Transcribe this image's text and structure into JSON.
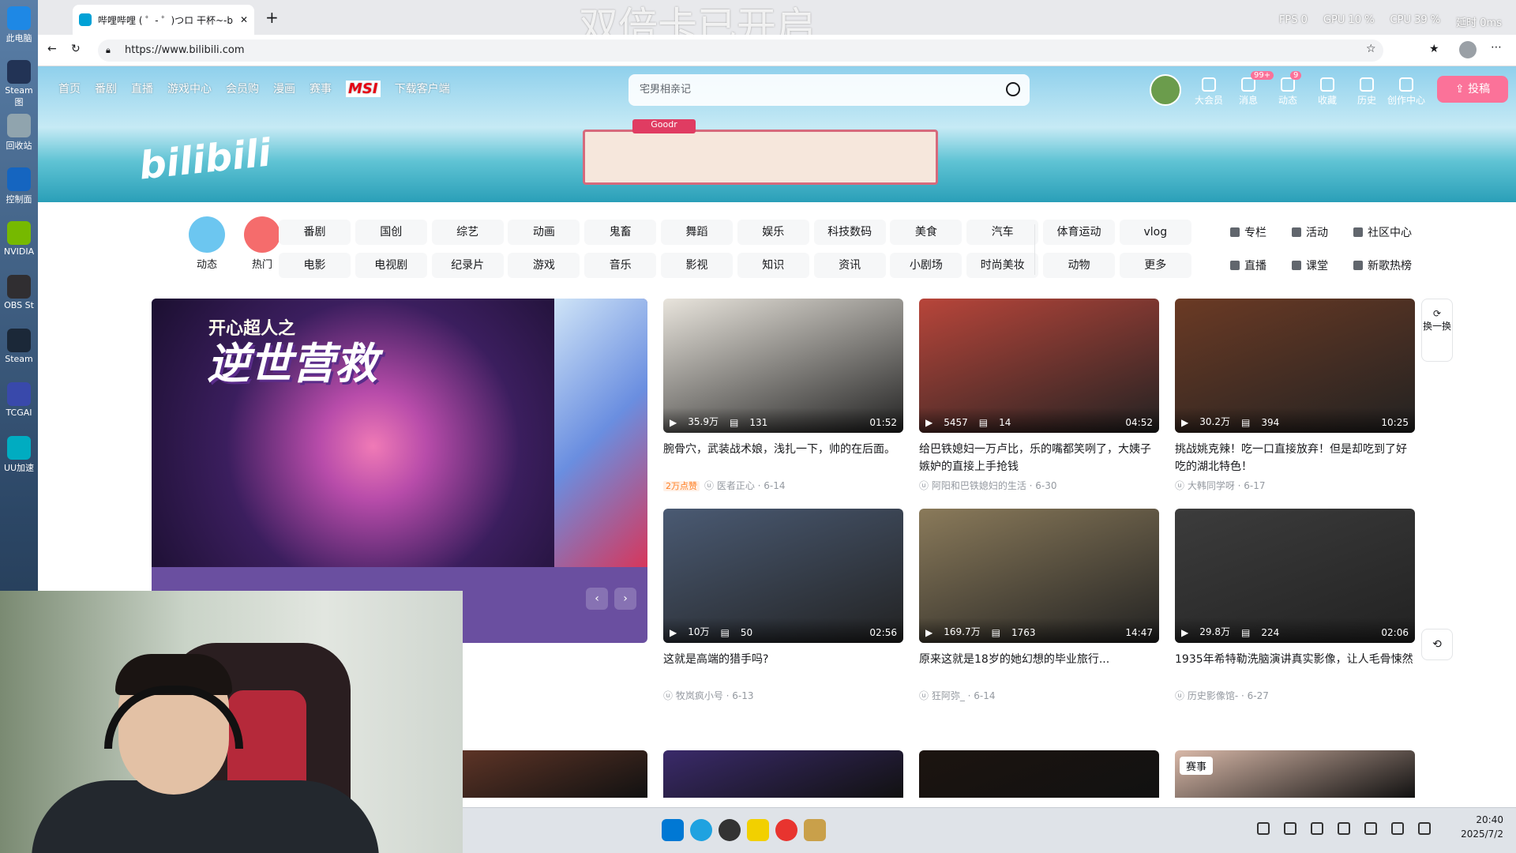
{
  "desktop": {
    "icons": [
      {
        "label": "此电脑",
        "color": "#1e88e5"
      },
      {
        "label": "Steam图",
        "color": "#223355"
      },
      {
        "label": "回收站",
        "color": "#90a4ae"
      },
      {
        "label": "控制面",
        "color": "#1565c0"
      },
      {
        "label": "NVIDIA",
        "color": "#76b900"
      },
      {
        "label": "OBS St",
        "color": "#302e31"
      },
      {
        "label": "Steam",
        "color": "#1b2838"
      },
      {
        "label": "TCGAI",
        "color": "#3949ab"
      },
      {
        "label": "UU加速",
        "color": "#00acc1"
      }
    ]
  },
  "overlay": {
    "text": "双倍卡已开启"
  },
  "stats": {
    "fps_label": "FPS",
    "fps": "0",
    "gpu_label": "GPU",
    "gpu": "10 %",
    "cpu_label": "CPU",
    "cpu": "39 %",
    "latency": "延时 0ms"
  },
  "browser": {
    "tab_title": "哔哩哔哩 ( ゜- ゜)つロ 干杯~-bilibili",
    "url": "https://www.bilibili.com"
  },
  "header": {
    "nav": [
      "首页",
      "番剧",
      "直播",
      "游戏中心",
      "会员购",
      "漫画",
      "赛事"
    ],
    "msi": "MSI",
    "download": "下载客户端",
    "search_placeholder": "宅男相亲记",
    "right_nav": [
      {
        "label": "大会员",
        "badge": ""
      },
      {
        "label": "消息",
        "badge": "99+"
      },
      {
        "label": "动态",
        "badge": "9"
      },
      {
        "label": "收藏",
        "badge": ""
      },
      {
        "label": "历史",
        "badge": ""
      },
      {
        "label": "创作中心",
        "badge": ""
      }
    ],
    "upload": "投稿",
    "logo": "bilibili"
  },
  "channels": {
    "quick": [
      {
        "label": "动态",
        "color": "#6cc6f0"
      },
      {
        "label": "热门",
        "color": "#f56c6c"
      }
    ],
    "row1": [
      "番剧",
      "国创",
      "综艺",
      "动画",
      "鬼畜",
      "舞蹈",
      "娱乐",
      "科技数码",
      "美食",
      "汽车",
      "体育运动",
      "vlog"
    ],
    "row2": [
      "电影",
      "电视剧",
      "纪录片",
      "游戏",
      "音乐",
      "影视",
      "知识",
      "资讯",
      "小剧场",
      "时尚美妆",
      "动物",
      "更多"
    ],
    "side_row1": [
      "专栏",
      "活动",
      "社区中心"
    ],
    "side_row2": [
      "直播",
      "课堂",
      "新歌热榜"
    ]
  },
  "carousel": {
    "subtitle": "开心超人之",
    "title": "逆世营救"
  },
  "refresh": {
    "label": "换一换"
  },
  "cards": [
    {
      "title": "腕骨穴，武装战术娘，浅扎一下，帅的在后面。",
      "views": "35.9万",
      "danmaku": "131",
      "duration": "01:52",
      "tag": "2万点赞",
      "author": "医者正心",
      "date": "6-14",
      "color": "#e8e4dc"
    },
    {
      "title": "给巴铁媳妇一万卢比，乐的嘴都笑咧了，大姨子嫉妒的直接上手抢钱",
      "views": "5457",
      "danmaku": "14",
      "duration": "04:52",
      "tag": "",
      "author": "阿阳和巴铁媳妇的生活",
      "date": "6-30",
      "color": "#b8453a"
    },
    {
      "title": "挑战姚克辣！吃一口直接放弃！但是却吃到了好吃的湖北特色！",
      "views": "30.2万",
      "danmaku": "394",
      "duration": "10:25",
      "tag": "",
      "author": "大韩同学呀",
      "date": "6-17",
      "color": "#6b3a24"
    },
    {
      "title": "这就是高端的猎手吗?",
      "views": "10万",
      "danmaku": "50",
      "duration": "02:56",
      "tag": "",
      "author": "牧岚疯小号",
      "date": "6-13",
      "color": "#4a5a73"
    },
    {
      "title": "原来这就是18岁的她幻想的毕业旅行...",
      "views": "169.7万",
      "danmaku": "1763",
      "duration": "14:47",
      "tag": "",
      "author": "狂阿弥_",
      "date": "6-14",
      "color": "#8a7a5a"
    },
    {
      "title": "1935年希特勒洗脑演讲真实影像，让人毛骨悚然",
      "views": "29.8万",
      "danmaku": "224",
      "duration": "02:06",
      "tag": "",
      "author": "历史影像馆-",
      "date": "6-27",
      "color": "#3c3c3c"
    }
  ],
  "row3": [
    {
      "color": "#6a3a2a",
      "tag": ""
    },
    {
      "color": "#3a2a6a",
      "tag": ""
    },
    {
      "color": "#1c1410",
      "tag": ""
    },
    {
      "color": "#d8b8a8",
      "tag": "赛事"
    }
  ],
  "tray": {
    "time": "20:40",
    "date": "2025/7/2"
  }
}
